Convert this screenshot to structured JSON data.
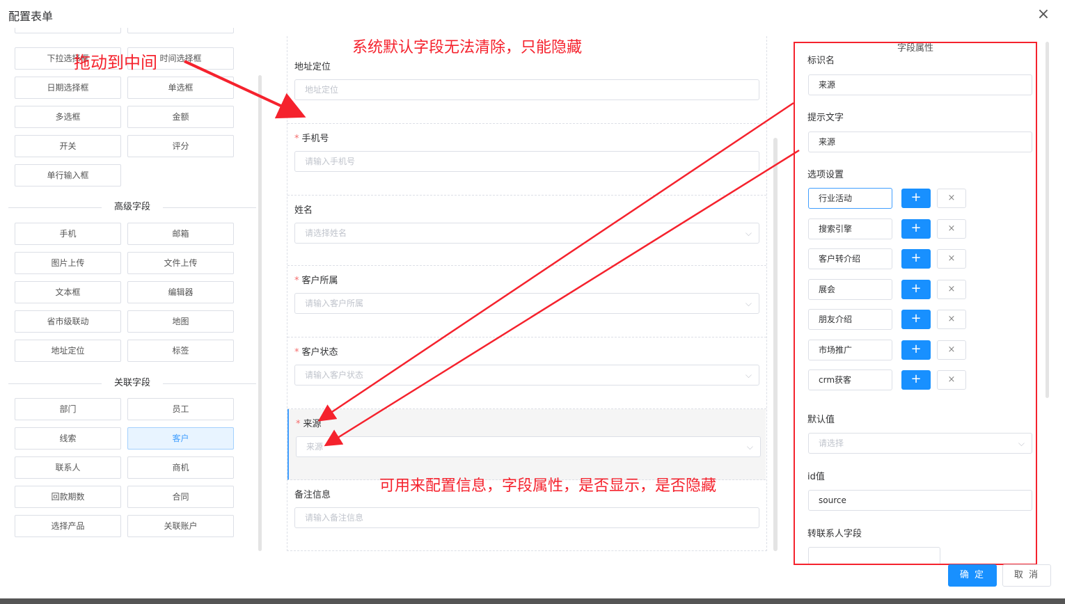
{
  "dialog": {
    "title": "配置表单",
    "ok_label": "确 定",
    "cancel_label": "取 消"
  },
  "left": {
    "basic_items": [
      "下拉选择框",
      "时间选择框",
      "日期选择框",
      "单选框",
      "多选框",
      "金额",
      "开关",
      "评分",
      "单行输入框"
    ],
    "advanced_title": "高级字段",
    "advanced_items": [
      "手机",
      "邮箱",
      "图片上传",
      "文件上传",
      "文本框",
      "编辑器",
      "省市级联动",
      "地图",
      "地址定位",
      "标签"
    ],
    "related_title": "关联字段",
    "related_items": [
      "部门",
      "员工",
      "线索",
      "客户",
      "联系人",
      "商机",
      "回款期数",
      "合同",
      "选择产品",
      "关联账户"
    ],
    "active_item": "客户"
  },
  "center": {
    "fields": [
      {
        "label": "地址定位",
        "required": false,
        "placeholder": "地址定位",
        "select": false
      },
      {
        "label": "手机号",
        "required": true,
        "placeholder": "请输入手机号",
        "select": false
      },
      {
        "label": "姓名",
        "required": false,
        "placeholder": "请选择姓名",
        "select": true
      },
      {
        "label": "客户所属",
        "required": true,
        "placeholder": "请输入客户所属",
        "select": true
      },
      {
        "label": "客户状态",
        "required": true,
        "placeholder": "请输入客户状态",
        "select": true
      },
      {
        "label": "来源",
        "required": true,
        "placeholder": "来源",
        "select": true,
        "selected": true
      },
      {
        "label": "备注信息",
        "required": false,
        "placeholder": "请输入备注信息",
        "select": false
      }
    ]
  },
  "right": {
    "title": "字段属性",
    "id_name_label": "标识名",
    "id_name_value": "来源",
    "hint_label": "提示文字",
    "hint_value": "来源",
    "options_label": "选项设置",
    "options": [
      "行业活动",
      "搜索引擎",
      "客户转介绍",
      "展会",
      "朋友介绍",
      "市场推广",
      "crm获客"
    ],
    "default_label": "默认值",
    "default_placeholder": "请选择",
    "id_label": "id值",
    "id_value": "source",
    "convert_label": "转联系人字段"
  },
  "annotations": {
    "drag": "拖动到中间",
    "system": "系统默认字段无法清除，只能隐藏",
    "config": "可用来配置信息，字段属性，是否显示，是否隐藏"
  },
  "colors": {
    "accent": "#1890ff",
    "annotation": "#f5222d",
    "required": "#f56c6c"
  }
}
